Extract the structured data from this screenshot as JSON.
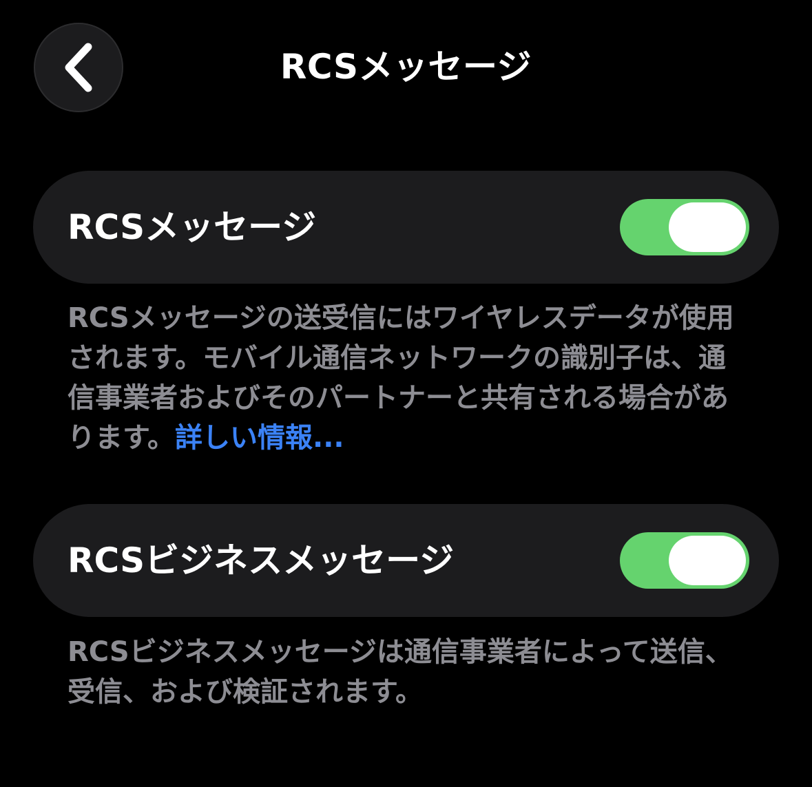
{
  "header": {
    "title": "RCSメッセージ",
    "back_icon": "chevron-left-icon"
  },
  "settings": [
    {
      "label": "RCSメッセージ",
      "toggle_on": true,
      "footnote": "RCSメッセージの送受信にはワイヤレスデータが使用されます。モバイル通信ネットワークの識別子は、通信事業者およびそのパートナーと共有される場合があります。",
      "link": "詳しい情報..."
    },
    {
      "label": "RCSビジネスメッセージ",
      "toggle_on": true,
      "footnote": "RCSビジネスメッセージは通信事業者によって送信、受信、および検証されます。"
    }
  ],
  "colors": {
    "background": "#000000",
    "row_background": "#1c1c1e",
    "toggle_on": "#65d36e",
    "footnote_text": "#8d8d93",
    "link": "#3b82f6"
  }
}
